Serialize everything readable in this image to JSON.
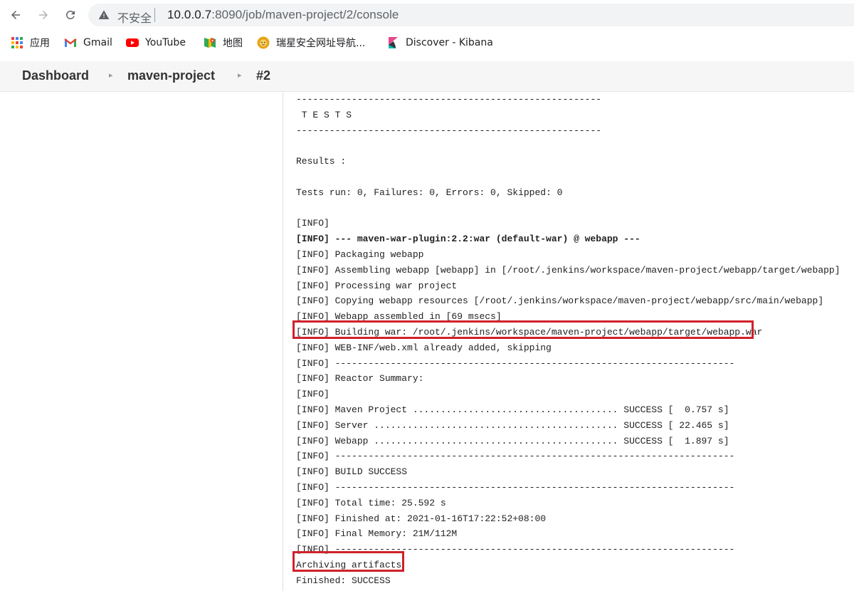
{
  "browser": {
    "security_label": "不安全",
    "url_host": "10.0.0.7",
    "url_path": ":8090/job/maven-project/2/console",
    "nav": {
      "back": "back-arrow-icon",
      "forward": "forward-arrow-icon",
      "reload": "reload-icon"
    }
  },
  "bookmarks": [
    {
      "label": "应用",
      "icon": "apps-grid-icon"
    },
    {
      "label": "Gmail",
      "icon": "gmail-icon"
    },
    {
      "label": "YouTube",
      "icon": "youtube-icon"
    },
    {
      "label": "地图",
      "icon": "maps-icon"
    },
    {
      "label": "瑞星安全网址导航...",
      "icon": "rising-lion-icon"
    },
    {
      "label": "Discover - Kibana",
      "icon": "kibana-icon"
    }
  ],
  "breadcrumb": {
    "items": [
      "Dashboard",
      "maven-project",
      "#2"
    ],
    "separator": "▸"
  },
  "console": {
    "lines": [
      "-------------------------------------------------------",
      " T E S T S",
      "-------------------------------------------------------",
      "",
      "Results :",
      "",
      "Tests run: 0, Failures: 0, Errors: 0, Skipped: 0",
      "",
      "[INFO]",
      "[INFO] --- maven-war-plugin:2.2:war (default-war) @ webapp ---",
      "[INFO] Packaging webapp",
      "[INFO] Assembling webapp [webapp] in [/root/.jenkins/workspace/maven-project/webapp/target/webapp]",
      "[INFO] Processing war project",
      "[INFO] Copying webapp resources [/root/.jenkins/workspace/maven-project/webapp/src/main/webapp]",
      "[INFO] Webapp assembled in [69 msecs]",
      "[INFO] Building war: /root/.jenkins/workspace/maven-project/webapp/target/webapp.war",
      "[INFO] WEB-INF/web.xml already added, skipping",
      "[INFO] ------------------------------------------------------------------------",
      "[INFO] Reactor Summary:",
      "[INFO]",
      "[INFO] Maven Project ..................................... SUCCESS [  0.757 s]",
      "[INFO] Server ............................................ SUCCESS [ 22.465 s]",
      "[INFO] Webapp ............................................ SUCCESS [  1.897 s]",
      "[INFO] ------------------------------------------------------------------------",
      "[INFO] BUILD SUCCESS",
      "[INFO] ------------------------------------------------------------------------",
      "[INFO] Total time: 25.592 s",
      "[INFO] Finished at: 2021-01-16T17:22:52+08:00",
      "[INFO] Final Memory: 21M/112M",
      "[INFO] ------------------------------------------------------------------------",
      "Archiving artifacts",
      "Finished: SUCCESS"
    ],
    "bold_line_index": 9,
    "highlight_color": "#d0212a"
  }
}
